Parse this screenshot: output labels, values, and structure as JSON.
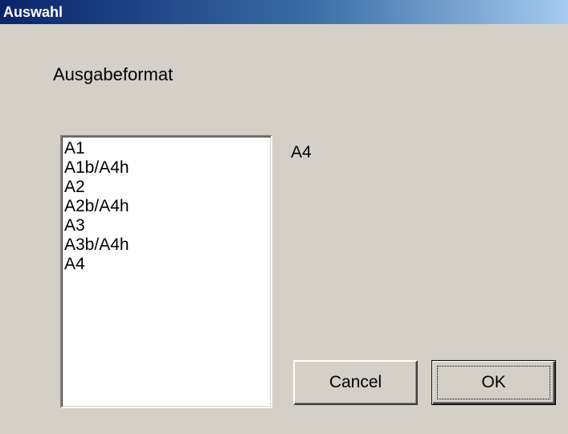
{
  "window": {
    "title": "Auswahl"
  },
  "dialog": {
    "heading": "Ausgabeformat",
    "list": {
      "items": [
        "A1",
        "A1b/A4h",
        "A2",
        "A2b/A4h",
        "A3",
        "A3b/A4h",
        "A4"
      ]
    },
    "selected_value": "A4",
    "buttons": {
      "cancel_label": "Cancel",
      "ok_label": "OK"
    }
  },
  "colors": {
    "title_gradient_start": "#0a246a",
    "title_gradient_end": "#a6caf0",
    "dialog_background": "#d4d0c8",
    "list_background": "#ffffff"
  }
}
